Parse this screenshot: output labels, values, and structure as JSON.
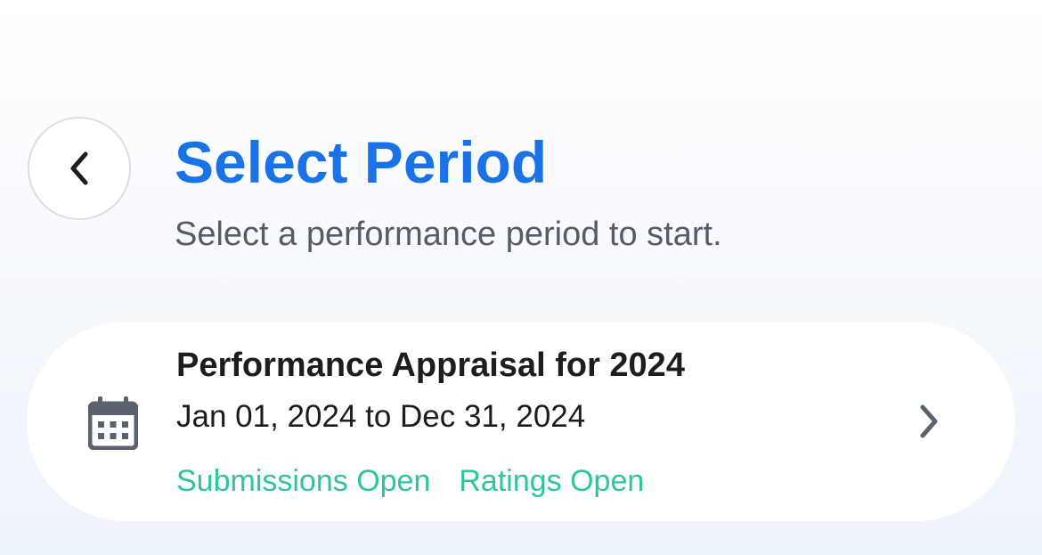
{
  "header": {
    "back_icon": "chevron-left-icon",
    "title": "Select Period",
    "subtitle": "Select a performance period to start."
  },
  "periods": [
    {
      "icon": "calendar-icon",
      "title": "Performance Appraisal for 2024",
      "dates": "Jan 01, 2024 to Dec 31, 2024",
      "statuses": [
        "Submissions Open",
        "Ratings Open"
      ],
      "chevron_icon": "chevron-right-icon"
    }
  ],
  "colors": {
    "title": "#1a73e6",
    "status": "#2ec4a0",
    "subtitle": "#565c66",
    "icon": "#5a6270"
  }
}
